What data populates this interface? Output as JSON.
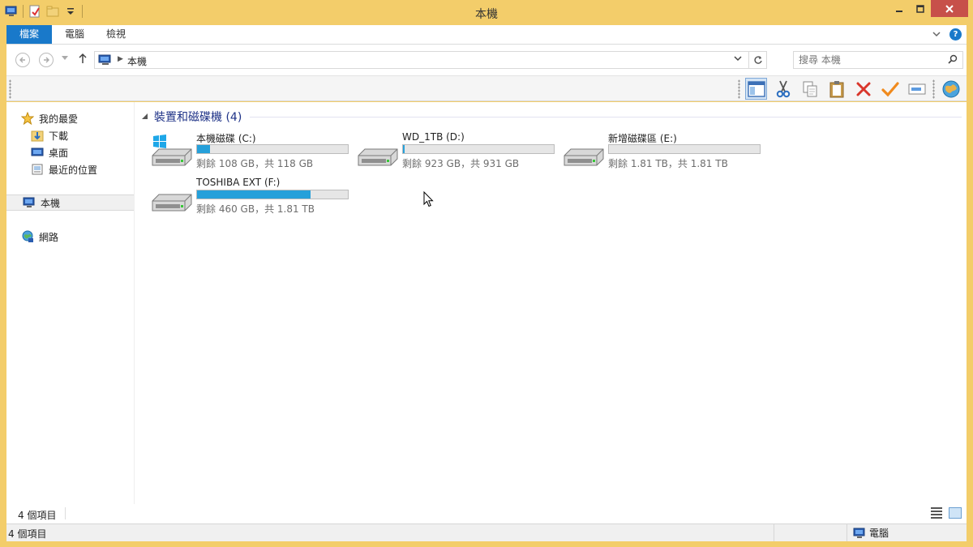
{
  "window": {
    "title": "本機"
  },
  "colors": {
    "accent": "#1979ca",
    "frame": "#f3cd6a",
    "bar_fill": "#26a0da",
    "group_header": "#1e3287"
  },
  "ribbon": {
    "tabs": [
      "檔案",
      "電腦",
      "檢視"
    ]
  },
  "address": {
    "crumb": "本機"
  },
  "search": {
    "placeholder": "搜尋 本機"
  },
  "toolbar": {
    "icons": [
      "preview-pane-icon",
      "cut-icon",
      "copy-icon",
      "paste-icon",
      "delete-icon",
      "properties-check-icon",
      "rename-icon",
      "globe-icon"
    ]
  },
  "nav": {
    "favorites": "我的最愛",
    "downloads": "下載",
    "desktop": "桌面",
    "recent": "最近的位置",
    "this_pc": "本機",
    "network": "網路"
  },
  "group": {
    "title": "裝置和磁碟機 (4)"
  },
  "drives": [
    {
      "name": "本機磁碟 (C:)",
      "free_text": "剩餘 108 GB，共 118 GB",
      "used_fraction": 0.085,
      "icon": "windows-drive-icon"
    },
    {
      "name": "WD_1TB (D:)",
      "free_text": "剩餘 923 GB，共 931 GB",
      "used_fraction": 0.009,
      "icon": "hard-drive-icon"
    },
    {
      "name": "新增磁碟區 (E:)",
      "free_text": "剩餘 1.81 TB，共 1.81 TB",
      "used_fraction": 0.0,
      "icon": "hard-drive-icon"
    },
    {
      "name": "TOSHIBA EXT (F:)",
      "free_text": "剩餘 460 GB，共 1.81 TB",
      "used_fraction": 0.75,
      "icon": "hard-drive-icon"
    }
  ],
  "status": {
    "items": "4 個項目",
    "items2": "4 個項目",
    "location": "電腦"
  }
}
